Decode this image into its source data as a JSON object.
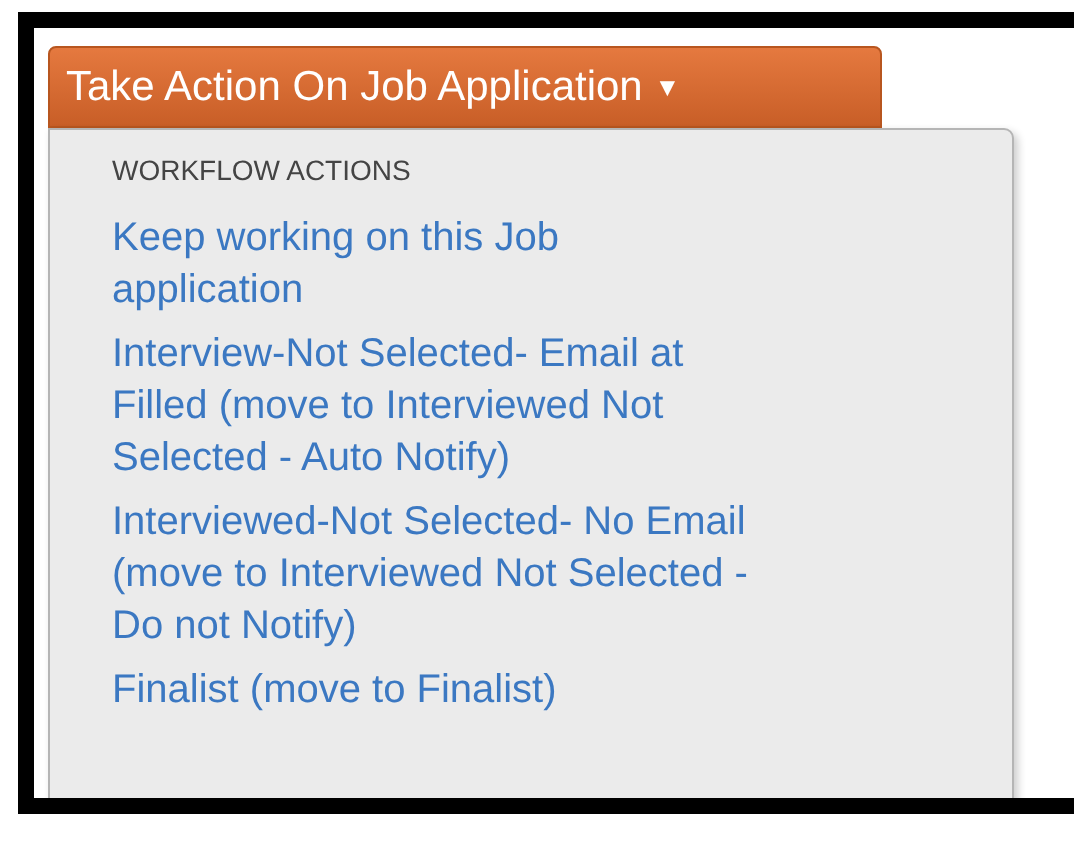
{
  "button": {
    "label": "Take Action On Job Application",
    "caret": "▼"
  },
  "menu": {
    "header": "WORKFLOW ACTIONS",
    "items": [
      {
        "lines": [
          "Keep working on this Job",
          "application"
        ]
      },
      {
        "lines": [
          "Interview-Not Selected- Email at",
          "Filled (move to Interviewed Not",
          "Selected - Auto Notify)"
        ]
      },
      {
        "lines": [
          "Interviewed-Not Selected- No Email",
          "(move to Interviewed Not Selected -",
          "Do not Notify)"
        ]
      },
      {
        "lines": [
          "Finalist (move to Finalist)"
        ]
      }
    ]
  }
}
